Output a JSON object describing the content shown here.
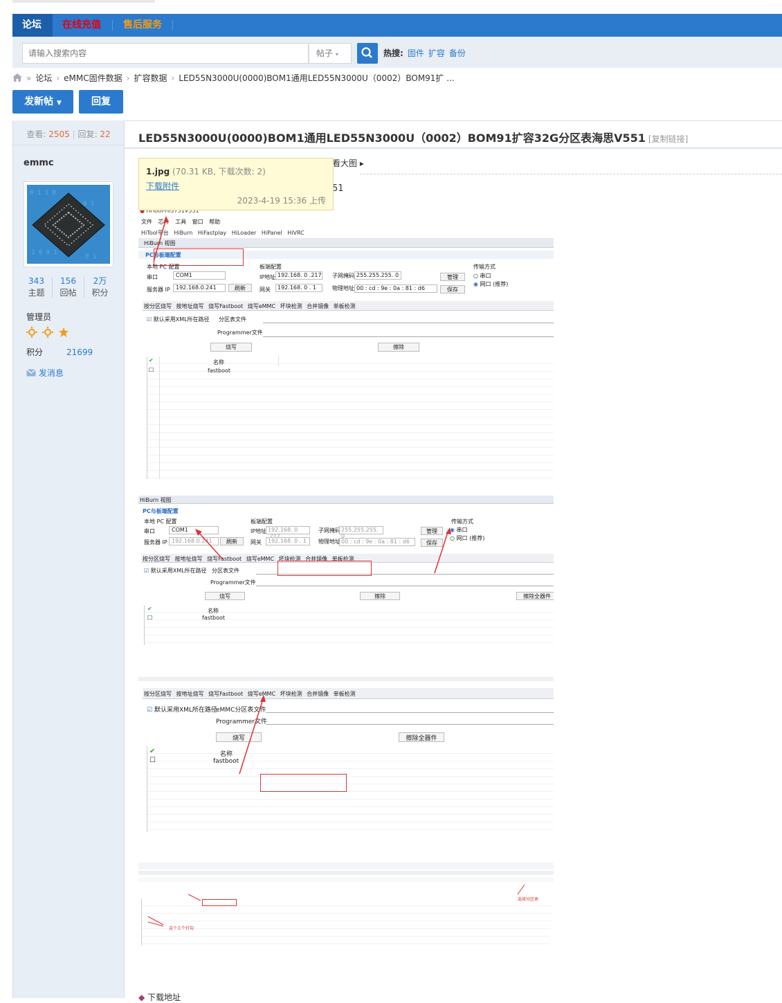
{
  "nav": {
    "items": [
      "论坛",
      "在线充值",
      "售后服务"
    ],
    "colors": {
      "forum": "#ffffff",
      "recharge": "#e60012",
      "service": "#f39b14"
    }
  },
  "search": {
    "placeholder": "请输入搜索内容",
    "type": "帖子",
    "hot_label": "热搜:",
    "hot": [
      "固件",
      "扩容",
      "备份"
    ]
  },
  "breadcrumb": [
    "论坛",
    "eMMC固件数据",
    "扩容数据",
    "LED55N3000U(0000)BOM1通用LED55N3000U（0002）BOM91扩 ..."
  ],
  "buttons": {
    "new_post": "发新帖",
    "reply": "回复"
  },
  "stats": {
    "views_label": "查看:",
    "views": "2505",
    "replies_label": "回复:",
    "replies": "22"
  },
  "post": {
    "title": "LED55N3000U(0000)BOM1通用LED55N3000U（0002）BOM91扩容32G分区表海思V551",
    "copy_link": "[复制链接]",
    "view_big": "看大图",
    "subtitle_fragment": "51",
    "download_footer": "下载地址"
  },
  "attachment": {
    "name": "1.jpg",
    "meta": "(70.31 KB, 下载次数: 2)",
    "link": "下载附件",
    "date": "2023-4-19 15:36 上传"
  },
  "user": {
    "name": "emmc",
    "stats": [
      {
        "value": "343",
        "label": "主题"
      },
      {
        "value": "156",
        "label": "回帖"
      },
      {
        "value": "2万",
        "label": "积分"
      }
    ],
    "role": "管理员",
    "score_label": "积分",
    "score": "21699",
    "message": "发消息"
  },
  "screens": {
    "s1": {
      "app_title": "HiTool-Hi3751V551",
      "menu": [
        "文件",
        "芯片",
        "工具",
        "窗口",
        "帮助"
      ],
      "toolbar": [
        "HiTool平台",
        "HiBurn",
        "HiFastplay",
        "HiLoader",
        "HiPanel",
        "HiVRC"
      ],
      "view": "HiBurn 视图",
      "section": "PC与板端配置",
      "local": "本地 PC 配置",
      "board": "板端配置",
      "transfer": "传输方式",
      "serial_label": "串口",
      "serial": "COM1",
      "server_label": "服务器 IP",
      "server": "192.168.0.241",
      "refresh": "刷新",
      "ip_label": "IP地址",
      "ip": "192.168. 0 .217",
      "gw_label": "网关",
      "gw": "192.168. 0 . 1",
      "mask_label": "子网掩码",
      "mask": "255.255.255. 0",
      "mac_label": "物理地址",
      "mac": "00 : cd : 9e : 0a : 81 : d6",
      "manage": "管理",
      "save": "保存",
      "radio1": "串口",
      "radio2": "网口 (推荐)",
      "tabs": [
        "按分区烧写",
        "按地址烧写",
        "烧写Fastboot",
        "烧写eMMC",
        "坏块检测",
        "合并镜像",
        "单板检测"
      ],
      "xml": "默认采用XML所在路径",
      "partition": "分区表文件",
      "programmer": "Programmer文件",
      "burn": "烧写",
      "erase": "擦除",
      "col_name": "名称",
      "row": "fastboot"
    },
    "s2": {
      "erase_all": "擦除全器件"
    },
    "s3": {
      "emmc_partition": "eMMC分区表文件"
    },
    "s4": {
      "note": "这个三个打勾",
      "note2": "选择分区表"
    }
  }
}
